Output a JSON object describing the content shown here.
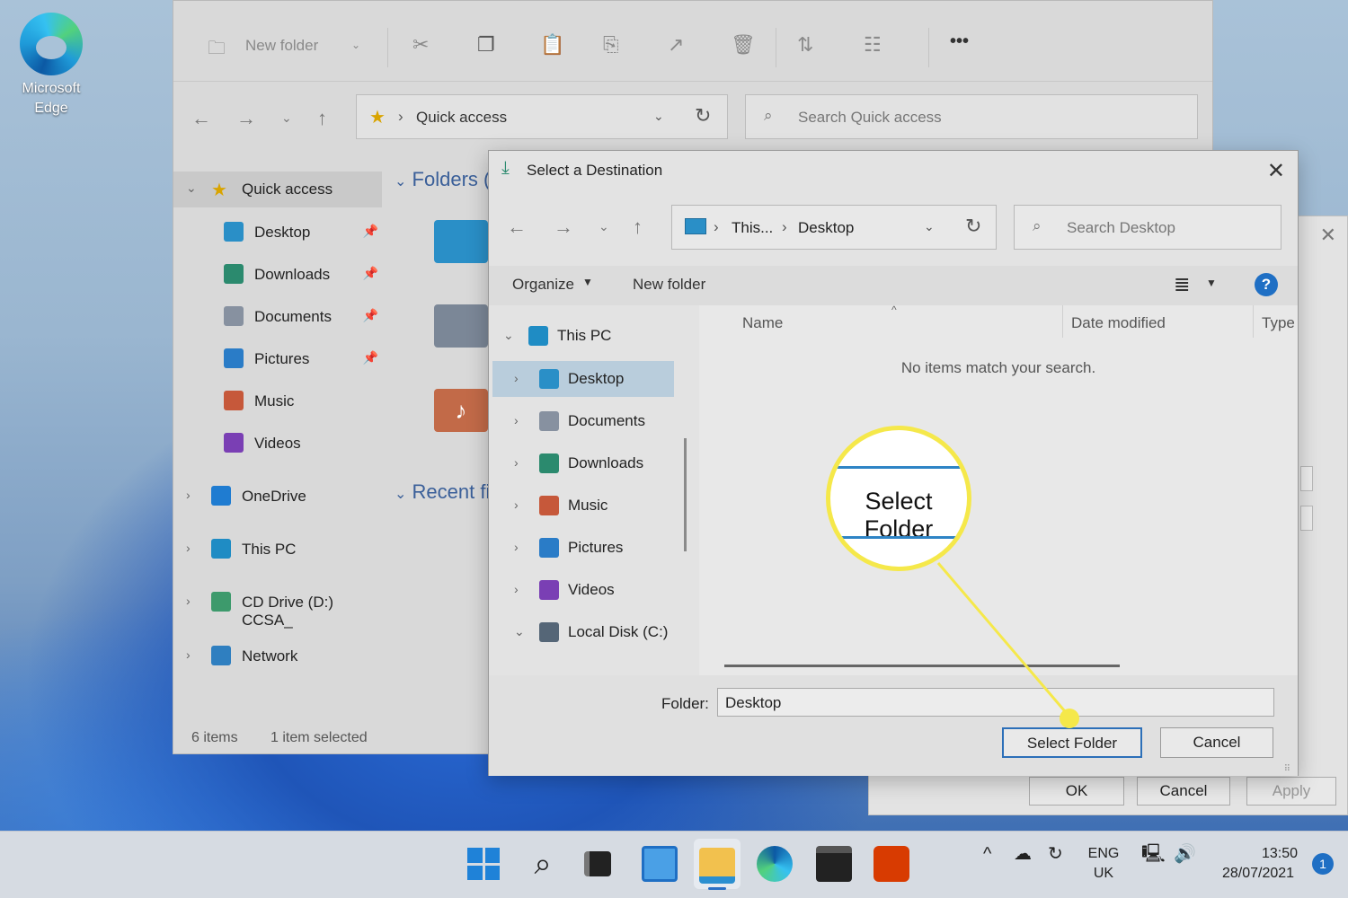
{
  "desktop": {
    "edge_label": "Microsoft Edge"
  },
  "explorer": {
    "toolbar": {
      "new_folder": "New folder",
      "more": "•••"
    },
    "address": "Quick access",
    "search_placeholder": "Search Quick access",
    "sidebar": [
      {
        "label": "Quick access",
        "icon": "star-icon"
      },
      {
        "label": "Desktop",
        "icon": "desktop-icon"
      },
      {
        "label": "Downloads",
        "icon": "download-icon"
      },
      {
        "label": "Documents",
        "icon": "documents-icon"
      },
      {
        "label": "Pictures",
        "icon": "pictures-icon"
      },
      {
        "label": "Music",
        "icon": "music-icon"
      },
      {
        "label": "Videos",
        "icon": "videos-icon"
      },
      {
        "label": "OneDrive",
        "icon": "cloud-icon"
      },
      {
        "label": "This PC",
        "icon": "monitor-icon"
      },
      {
        "label": "CD Drive (D:) CCSA_",
        "icon": "cd-drive-icon"
      },
      {
        "label": "Network",
        "icon": "network-icon"
      }
    ],
    "sections": {
      "folders": "Folders (",
      "recent": "Recent fi"
    },
    "status": {
      "items": "6 items",
      "selected": "1 item selected"
    }
  },
  "dialog": {
    "title": "Select a Destination",
    "address": {
      "root": "This...",
      "current": "Desktop"
    },
    "search_placeholder": "Search Desktop",
    "organize": "Organize",
    "new_folder": "New folder",
    "tree": [
      {
        "label": "This PC",
        "icon": "monitor-icon",
        "chevron": "v"
      },
      {
        "label": "Desktop",
        "icon": "desktop-icon",
        "chevron": ">"
      },
      {
        "label": "Documents",
        "icon": "documents-icon",
        "chevron": ">"
      },
      {
        "label": "Downloads",
        "icon": "download-icon",
        "chevron": ">"
      },
      {
        "label": "Music",
        "icon": "music-icon",
        "chevron": ">"
      },
      {
        "label": "Pictures",
        "icon": "pictures-icon",
        "chevron": ">"
      },
      {
        "label": "Videos",
        "icon": "videos-icon",
        "chevron": ">"
      },
      {
        "label": "Local Disk (C:)",
        "icon": "disk-icon",
        "chevron": "v"
      }
    ],
    "columns": {
      "name": "Name",
      "date": "Date modified",
      "type": "Type"
    },
    "empty_message": "No items match your search.",
    "folder_label": "Folder:",
    "folder_value": "Desktop",
    "select_button": "Select Folder",
    "cancel_button": "Cancel"
  },
  "callout": {
    "text": "Select Folder",
    "color": "#f5e84a"
  },
  "properties": {
    "ok": "OK",
    "cancel": "Cancel",
    "apply": "Apply"
  },
  "taskbar": {
    "lang1": "ENG",
    "lang2": "UK",
    "time": "13:50",
    "date": "28/07/2021",
    "notifications": "1"
  }
}
